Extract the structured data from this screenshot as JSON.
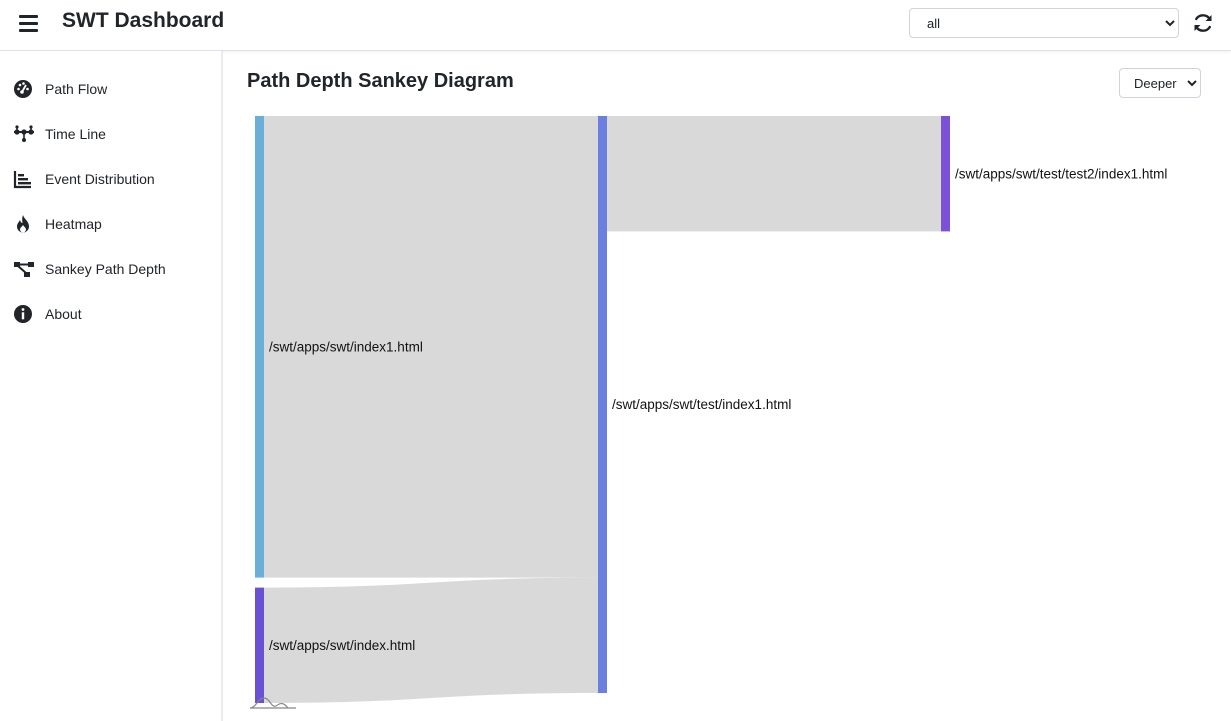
{
  "header": {
    "title": "SWT Dashboard",
    "filter": {
      "value": "all",
      "options": [
        "all"
      ]
    }
  },
  "sidebar": {
    "items": [
      {
        "label": "Path Flow",
        "icon": "tachometer-icon"
      },
      {
        "label": "Time Line",
        "icon": "timeline-icon"
      },
      {
        "label": "Event Distribution",
        "icon": "bar-chart-icon"
      },
      {
        "label": "Heatmap",
        "icon": "fire-icon"
      },
      {
        "label": "Sankey Path Depth",
        "icon": "sankey-icon"
      },
      {
        "label": "About",
        "icon": "info-circle-icon"
      }
    ]
  },
  "main": {
    "title": "Path Depth Sankey Diagram",
    "depth_select": {
      "value": "Deeper",
      "options": [
        "Deeper"
      ]
    }
  },
  "colors": {
    "link": "#d9d9d9",
    "node_index1": "#6baed6",
    "node_index": "#6a51d3",
    "node_test_index1": "#6b7fe0",
    "node_test2_index1": "#7b52d6"
  },
  "chart_data": {
    "type": "sankey",
    "nodes": [
      {
        "id": "n0",
        "name": "/swt/apps/swt/index1.html",
        "depth": 0,
        "color": "#6baed6"
      },
      {
        "id": "n1",
        "name": "/swt/apps/swt/index.html",
        "depth": 0,
        "color": "#6a51d3"
      },
      {
        "id": "n2",
        "name": "/swt/apps/swt/test/index1.html",
        "depth": 1,
        "color": "#6b7fe0"
      },
      {
        "id": "n3",
        "name": "/swt/apps/swt/test/test2/index1.html",
        "depth": 2,
        "color": "#7b52d6"
      }
    ],
    "links": [
      {
        "source": "n0",
        "target": "n2",
        "value": 4
      },
      {
        "source": "n1",
        "target": "n2",
        "value": 1
      },
      {
        "source": "n2",
        "target": "n3",
        "value": 1
      }
    ]
  }
}
